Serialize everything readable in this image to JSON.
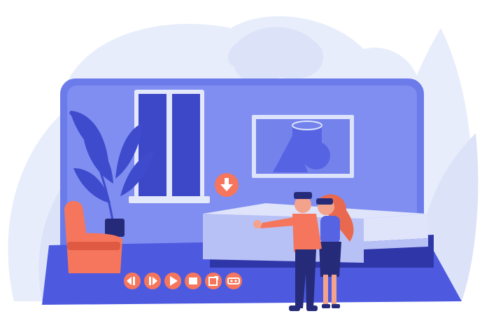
{
  "palette": {
    "background": "#ffffff",
    "leaf_light": "#e8edfb",
    "leaf_mid": "#dce3f8",
    "screen_frame": "#6c7bea",
    "room_wall": "#7f8ef0",
    "floor": "#4d5ae0",
    "window_frame": "#e3e8fb",
    "window_glass": "#3d48c9",
    "picture_frame": "#dce3fb",
    "picture_bg": "#7482ec",
    "shape_fill": "#5664e4",
    "bed_top": "#dfe4fb",
    "bed_side": "#b8c1f6",
    "bed_base": "#2e36a8",
    "accent_coral": "#f5765c",
    "accent_coral_dark": "#e05a43",
    "person_skin": "#f3a38c",
    "person_dark": "#252b78",
    "hair": "#e8694f",
    "plant": "#3e4bcd",
    "control_fill": "#f5765c",
    "control_glyph": "#ffffff"
  },
  "controls": [
    {
      "id": "rewind",
      "icon": "rewind-icon"
    },
    {
      "id": "fast-forward",
      "icon": "fast-forward-icon"
    },
    {
      "id": "play",
      "icon": "play-icon"
    },
    {
      "id": "stop",
      "icon": "stop-icon"
    },
    {
      "id": "share",
      "icon": "share-icon"
    },
    {
      "id": "vr",
      "icon": "vr-headset-icon"
    }
  ],
  "indicator": {
    "icon": "download-arrow-icon"
  }
}
